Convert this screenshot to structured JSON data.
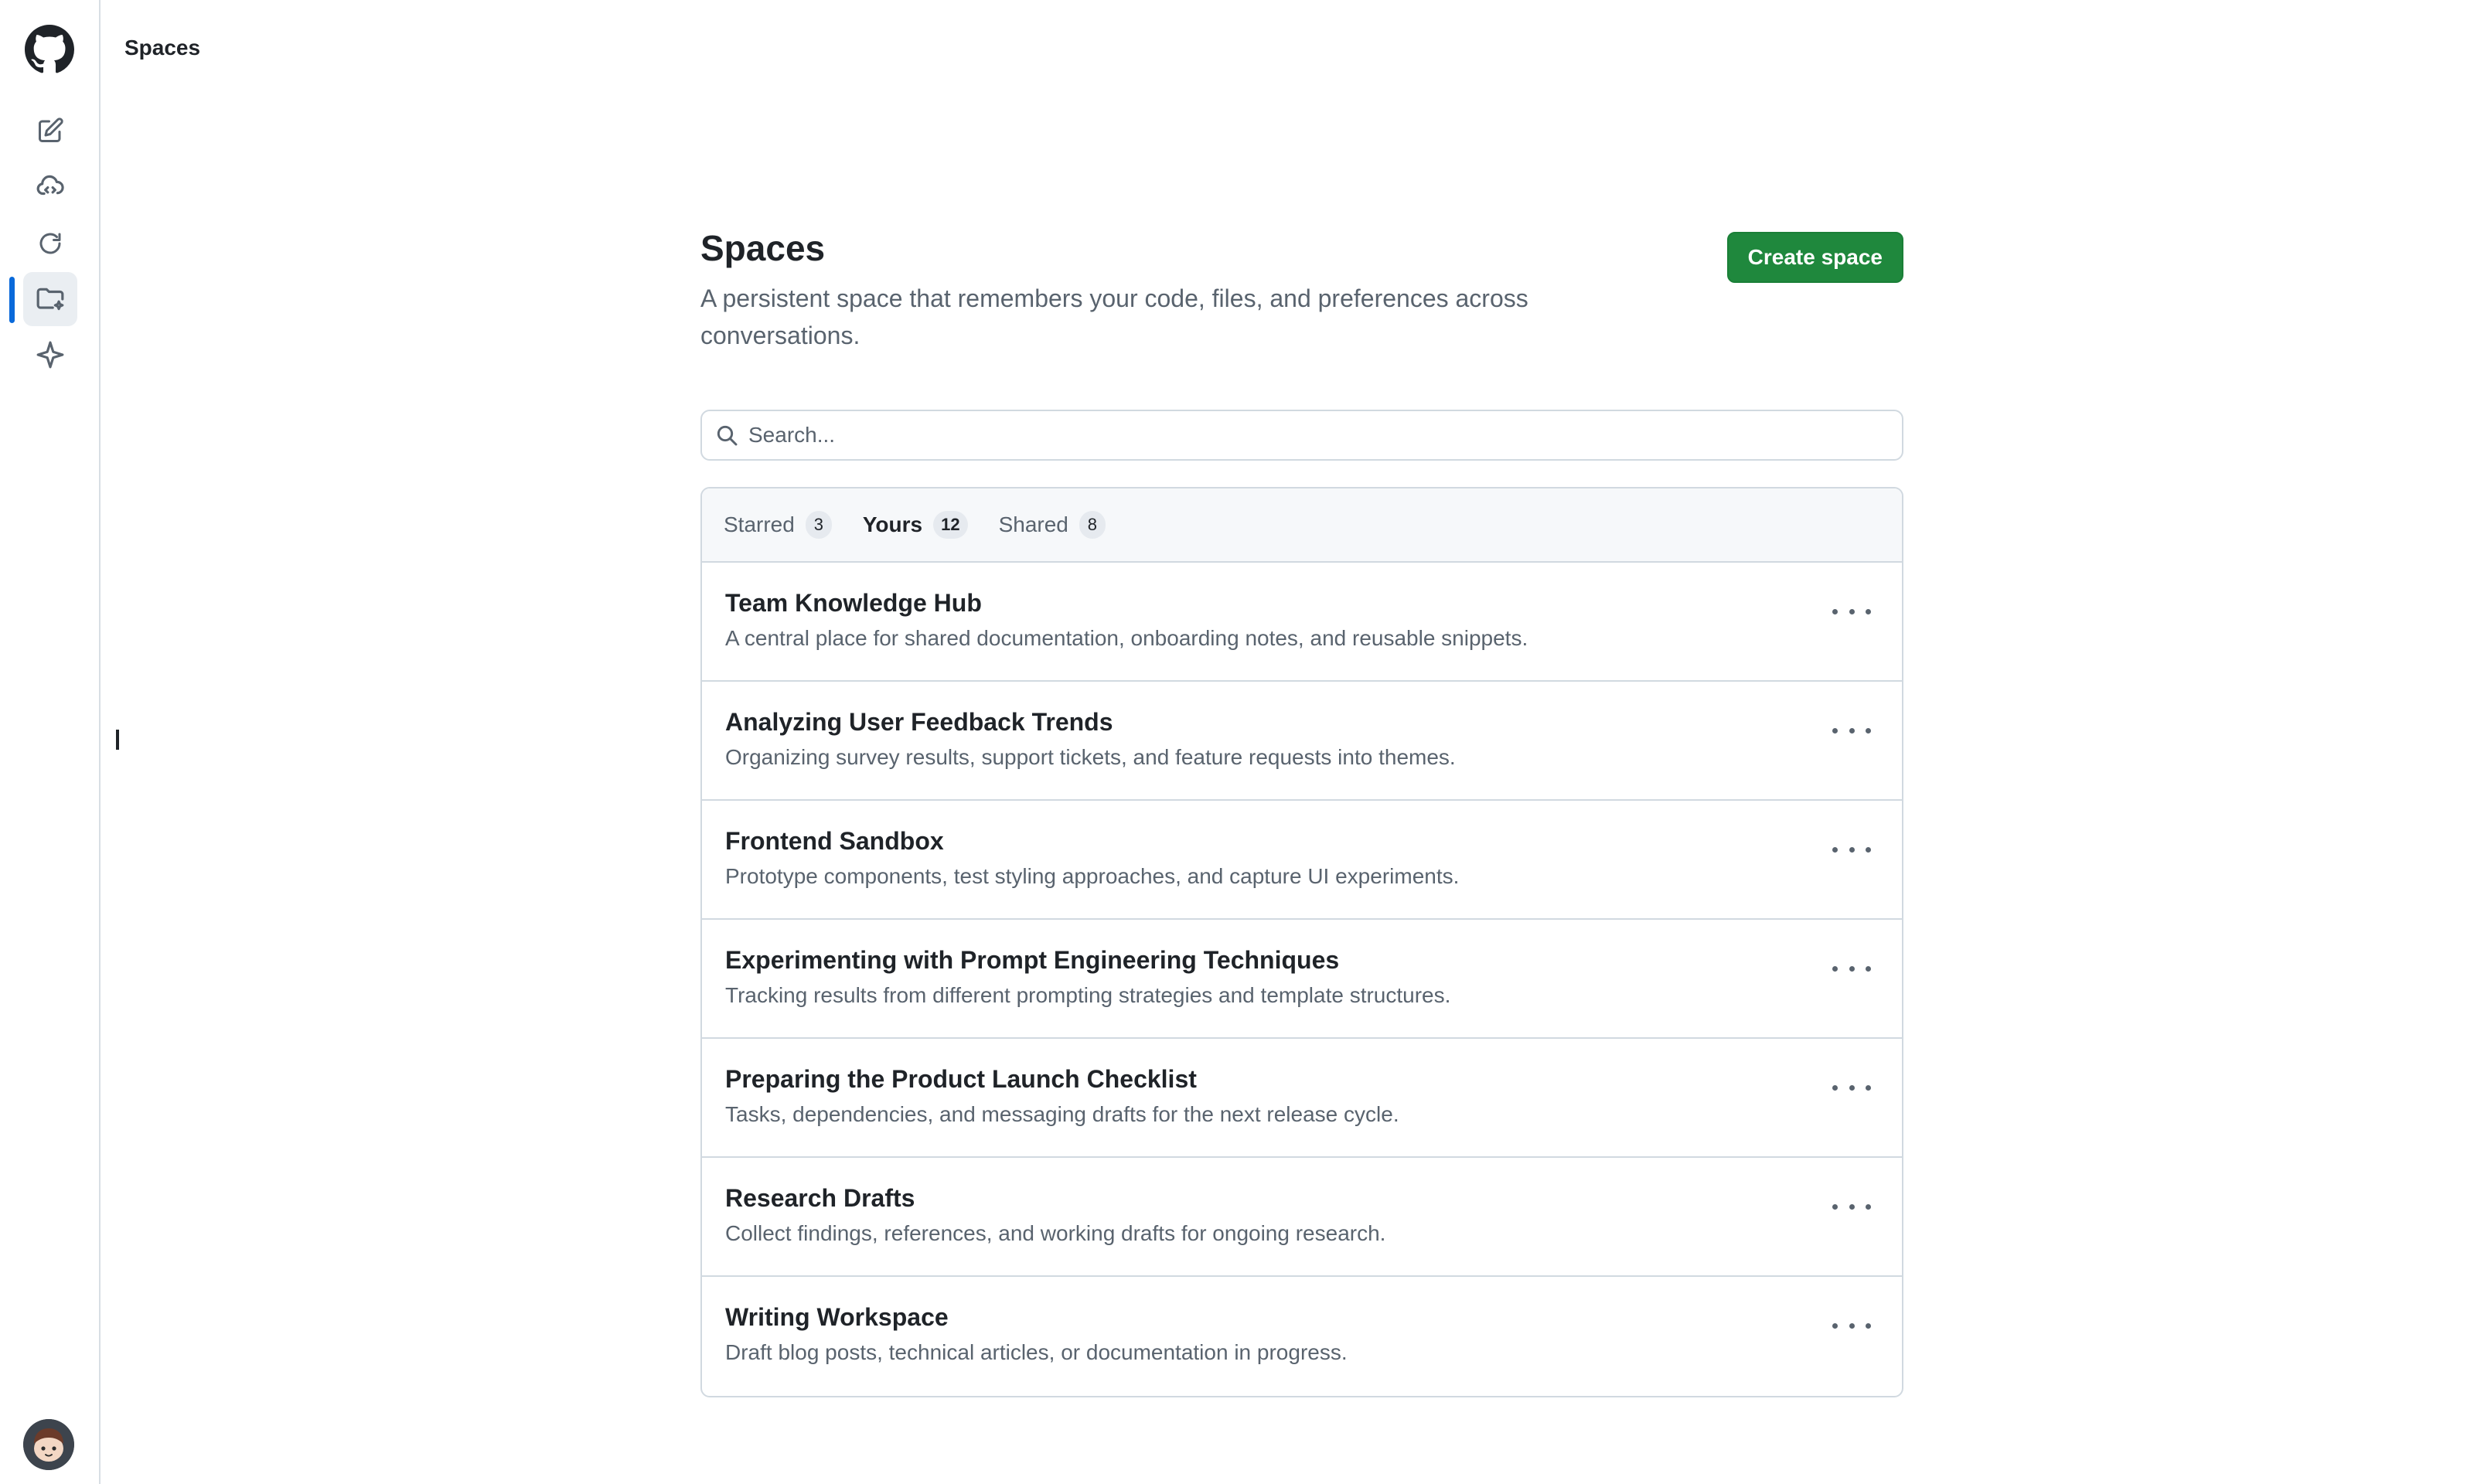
{
  "header": {
    "title": "Spaces"
  },
  "sidebar": {
    "items": [
      {
        "name": "new-chat",
        "icon": "pencil-square-icon"
      },
      {
        "name": "agents",
        "icon": "cloud-code-icon"
      },
      {
        "name": "history",
        "icon": "refresh-icon"
      },
      {
        "name": "spaces",
        "icon": "folder-sparkle-icon",
        "active": true
      },
      {
        "name": "copilot",
        "icon": "sparkle-icon"
      }
    ]
  },
  "main": {
    "title": "Spaces",
    "description": "A persistent space that remembers your code, files, and preferences across conversations.",
    "create_label": "Create space",
    "search_placeholder": "Search..."
  },
  "tabs": [
    {
      "label": "Starred",
      "count": "3",
      "active": false
    },
    {
      "label": "Yours",
      "count": "12",
      "active": true
    },
    {
      "label": "Shared",
      "count": "8",
      "active": false
    }
  ],
  "spaces": [
    {
      "title": "Team Knowledge Hub",
      "description": "A central place for shared documentation, onboarding notes, and reusable snippets."
    },
    {
      "title": "Analyzing User Feedback Trends",
      "description": "Organizing survey results, support tickets, and feature requests into themes."
    },
    {
      "title": "Frontend Sandbox",
      "description": "Prototype components, test styling approaches, and capture UI experiments."
    },
    {
      "title": "Experimenting with Prompt Engineering Techniques",
      "description": "Tracking results from different prompting strategies and template structures."
    },
    {
      "title": "Preparing the Product Launch Checklist",
      "description": "Tasks, dependencies, and messaging drafts for the next release cycle."
    },
    {
      "title": "Research Drafts",
      "description": "Collect findings, references, and working drafts for ongoing research."
    },
    {
      "title": "Writing Workspace",
      "description": "Draft blog posts, technical articles, or documentation in progress."
    }
  ],
  "colors": {
    "accent": "#0969da",
    "primary_button": "#1f883d",
    "text": "#1f2328",
    "muted": "#59636e"
  }
}
